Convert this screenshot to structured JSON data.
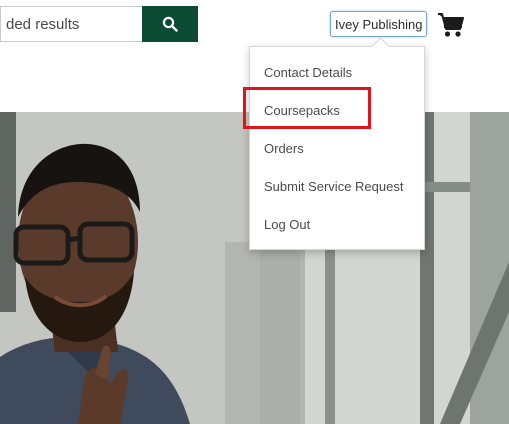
{
  "search": {
    "value": "ded results",
    "icon": "search-icon"
  },
  "account": {
    "label": "Ivey Publishing"
  },
  "cart": {
    "icon": "cart-icon"
  },
  "menu": {
    "items": [
      {
        "label": "Contact Details"
      },
      {
        "label": "Coursepacks"
      },
      {
        "label": "Orders"
      },
      {
        "label": "Submit Service Request"
      },
      {
        "label": "Log Out"
      }
    ]
  },
  "colors": {
    "brand_green": "#0b4b33",
    "highlight_red": "#e3131c"
  }
}
